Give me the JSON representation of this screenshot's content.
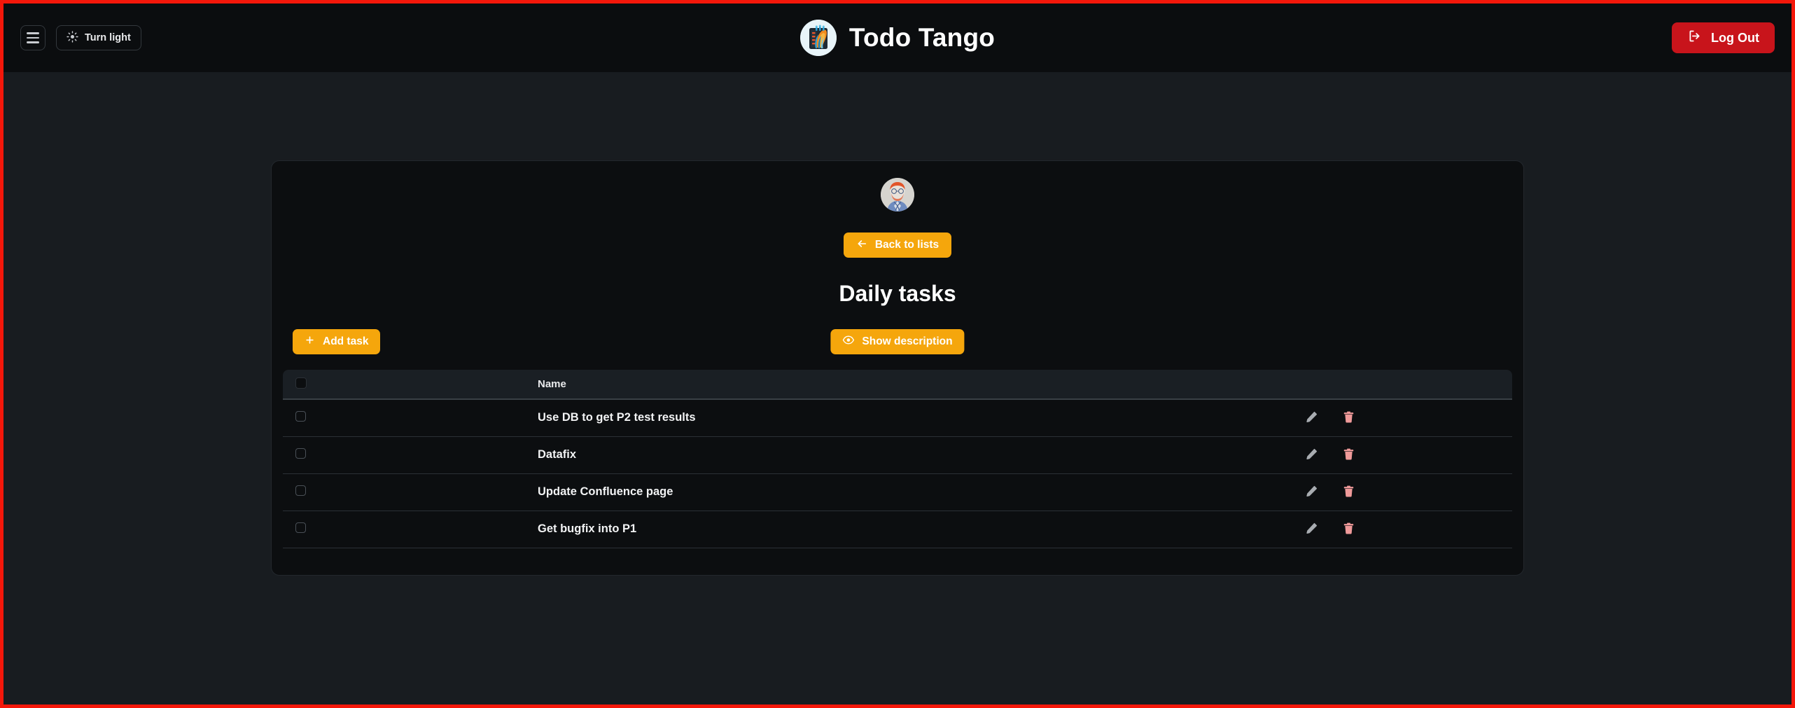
{
  "topbar": {
    "menu_icon": "hamburger-menu-icon",
    "theme_toggle": {
      "label": "Turn light",
      "icon": "sun-icon"
    },
    "brand": {
      "title": "Todo Tango",
      "logo_icon": "todo-tango-logo"
    },
    "logout": {
      "label": "Log Out",
      "icon": "logout-icon"
    }
  },
  "card": {
    "avatar_icon": "user-avatar",
    "back_button": {
      "label": "Back to lists",
      "icon": "arrow-left-icon"
    },
    "title": "Daily tasks",
    "add_task_button": {
      "label": "Add task",
      "icon": "plus-icon"
    },
    "show_description_button": {
      "label": "Show description",
      "icon": "eye-icon"
    },
    "table": {
      "columns": [
        "",
        "",
        "Name",
        ""
      ],
      "name_header": "Name",
      "rows": [
        {
          "name": "Use DB to get P2 test results",
          "checked": false,
          "edit_icon": "pencil-icon",
          "delete_icon": "trash-icon"
        },
        {
          "name": "Datafix",
          "checked": false,
          "edit_icon": "pencil-icon",
          "delete_icon": "trash-icon"
        },
        {
          "name": "Update Confluence page",
          "checked": false,
          "edit_icon": "pencil-icon",
          "delete_icon": "trash-icon"
        },
        {
          "name": "Get bugfix into P1",
          "checked": false,
          "edit_icon": "pencil-icon",
          "delete_icon": "trash-icon"
        }
      ]
    }
  },
  "colors": {
    "accent_amber": "#f5a60c",
    "logout_red": "#c8141b",
    "delete_icon": "#ef9a9a",
    "edit_icon": "#a8acb1",
    "page_background": "#181c20",
    "card_background": "#0c0e10",
    "topbar_background": "#0b0d0f",
    "recording_border": "#f4170a"
  }
}
